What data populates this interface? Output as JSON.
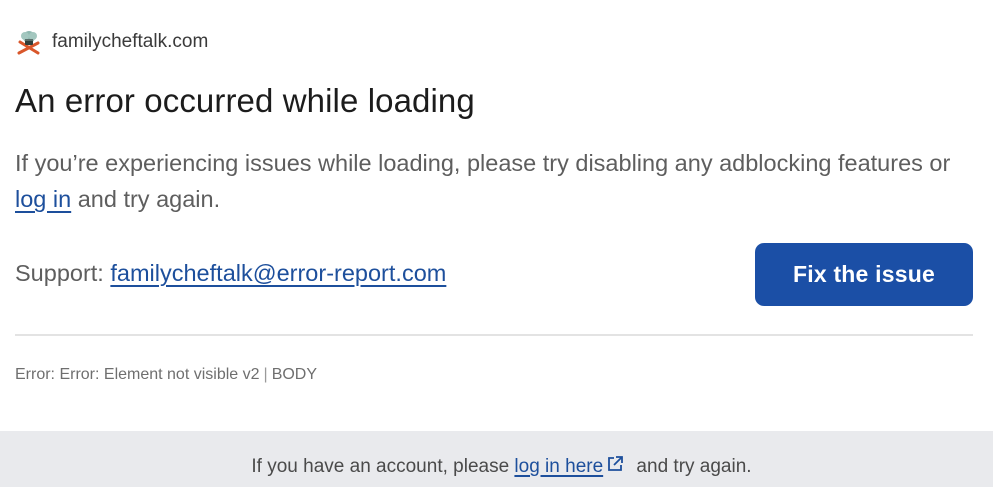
{
  "header": {
    "site_name": "familycheftalk.com",
    "logo_icon": "chef-hat-utensils-logo"
  },
  "main": {
    "title": "An error occurred while loading",
    "message_before": "If you’re experiencing issues while loading, please try disabling any adblocking features or ",
    "login_link": "log in",
    "message_after": " and try again.",
    "support_label": "Support: ",
    "support_email": "familycheftalk@error-report.com",
    "fix_button": "Fix the issue"
  },
  "error": {
    "text": "Error: Error: Element not visible v2",
    "separator": "|",
    "element": "BODY"
  },
  "footer": {
    "before": "If you have an account, please ",
    "login_link": "log in here",
    "link_icon": "external-link-icon",
    "after": " and try again."
  },
  "colors": {
    "accent": "#1b4fa6",
    "link": "#1d4f9c",
    "footer_bg": "#e9eaed"
  }
}
